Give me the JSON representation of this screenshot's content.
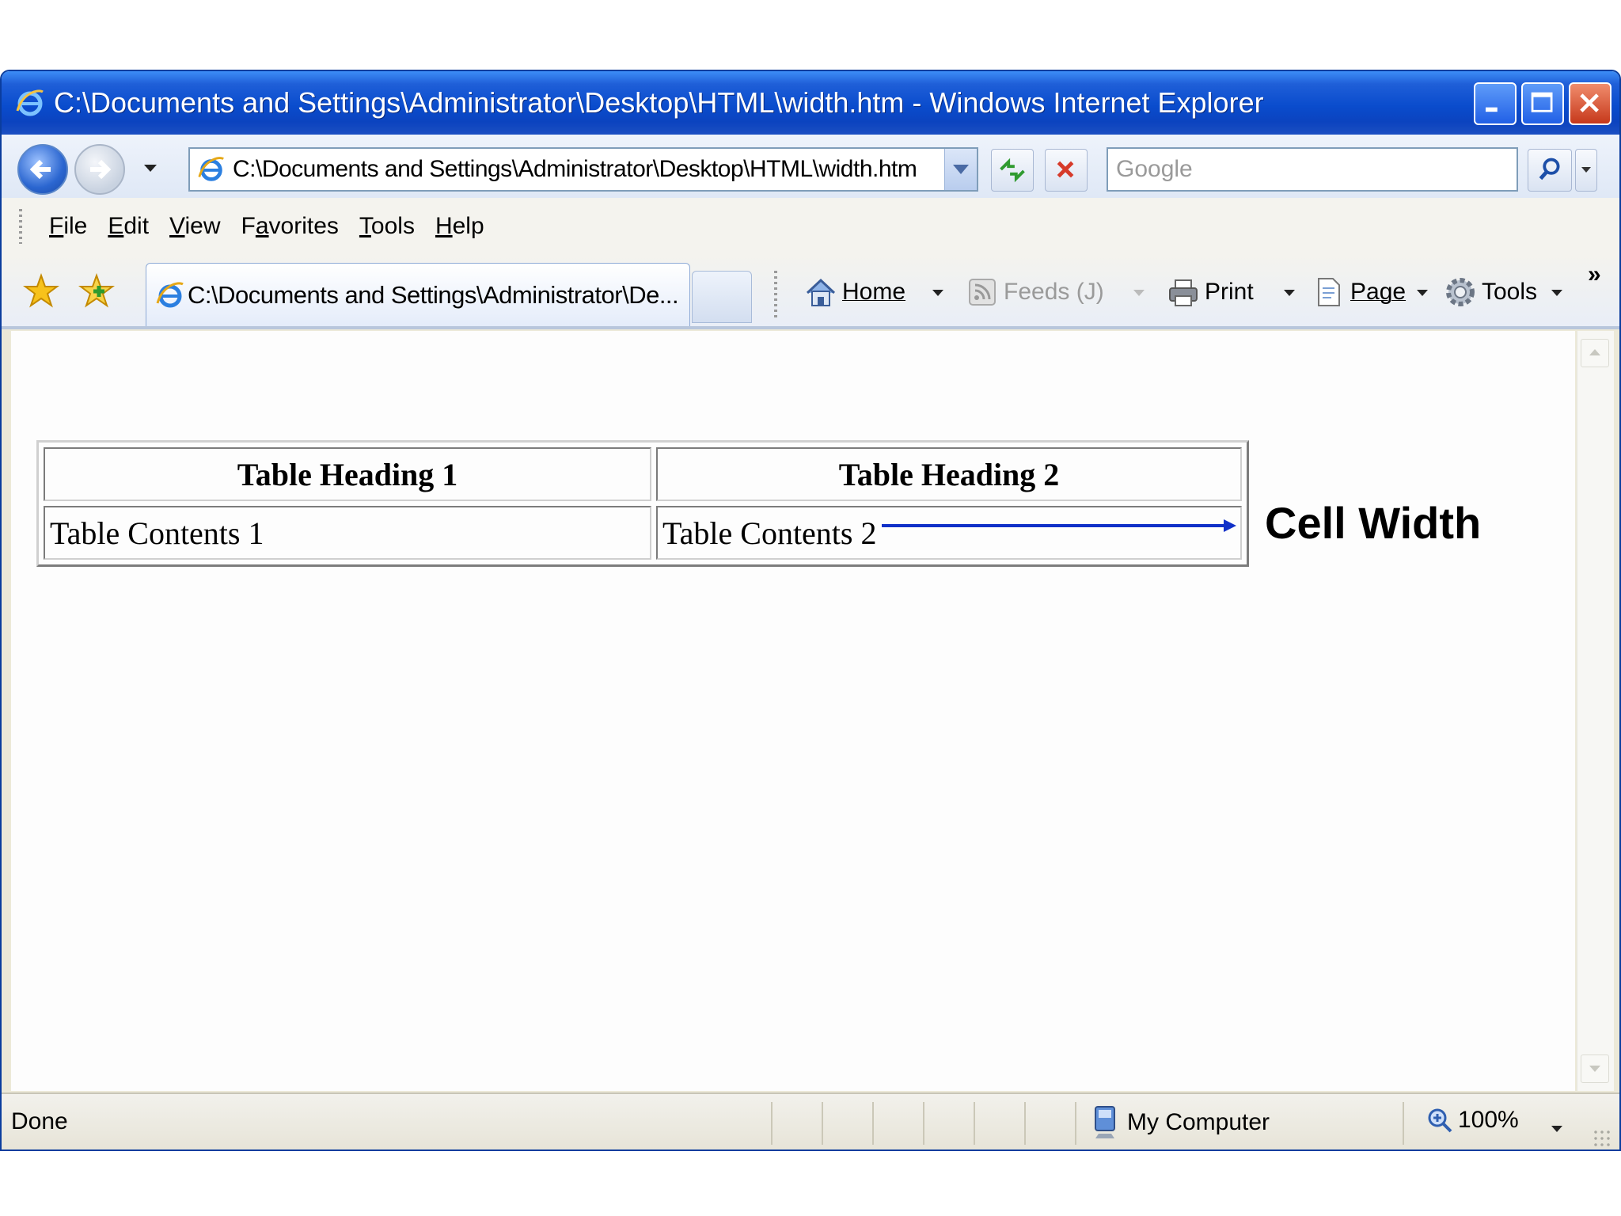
{
  "window": {
    "title": "C:\\Documents and Settings\\Administrator\\Desktop\\HTML\\width.htm - Windows Internet Explorer"
  },
  "address_bar": {
    "url": "C:\\Documents and Settings\\Administrator\\Desktop\\HTML\\width.htm"
  },
  "search": {
    "placeholder": "Google"
  },
  "menu": {
    "items": [
      {
        "label": "File",
        "accel": "F",
        "rest": "ile"
      },
      {
        "label": "Edit",
        "accel": "E",
        "rest": "dit"
      },
      {
        "label": "View",
        "accel": "V",
        "rest": "iew"
      },
      {
        "label": "Favorites",
        "pre": "F",
        "accel": "a",
        "rest": "vorites"
      },
      {
        "label": "Tools",
        "accel": "T",
        "rest": "ools"
      },
      {
        "label": "Help",
        "accel": "H",
        "rest": "elp"
      }
    ]
  },
  "tabs": {
    "active_label": "C:\\Documents and Settings\\Administrator\\De..."
  },
  "command_bar": {
    "home": "Home",
    "feeds": "Feeds (J)",
    "print": "Print",
    "page": "Page",
    "tools": "Tools"
  },
  "page": {
    "table": {
      "headers": [
        "Table Heading 1",
        "Table Heading 2"
      ],
      "rows": [
        [
          "Table Contents 1",
          "Table Contents 2"
        ]
      ]
    },
    "annotation": "Cell Width",
    "arrow_color": "#1030c8"
  },
  "status_bar": {
    "text": "Done",
    "zone": "My Computer",
    "zoom": "100%"
  },
  "icons": [
    "ie-icon",
    "back-icon",
    "forward-icon",
    "refresh-icon",
    "stop-icon",
    "search-icon",
    "favorites-star-icon",
    "add-favorites-icon",
    "home-icon",
    "feeds-icon",
    "print-icon",
    "page-icon",
    "tools-gear-icon",
    "computer-icon",
    "zoom-icon"
  ]
}
